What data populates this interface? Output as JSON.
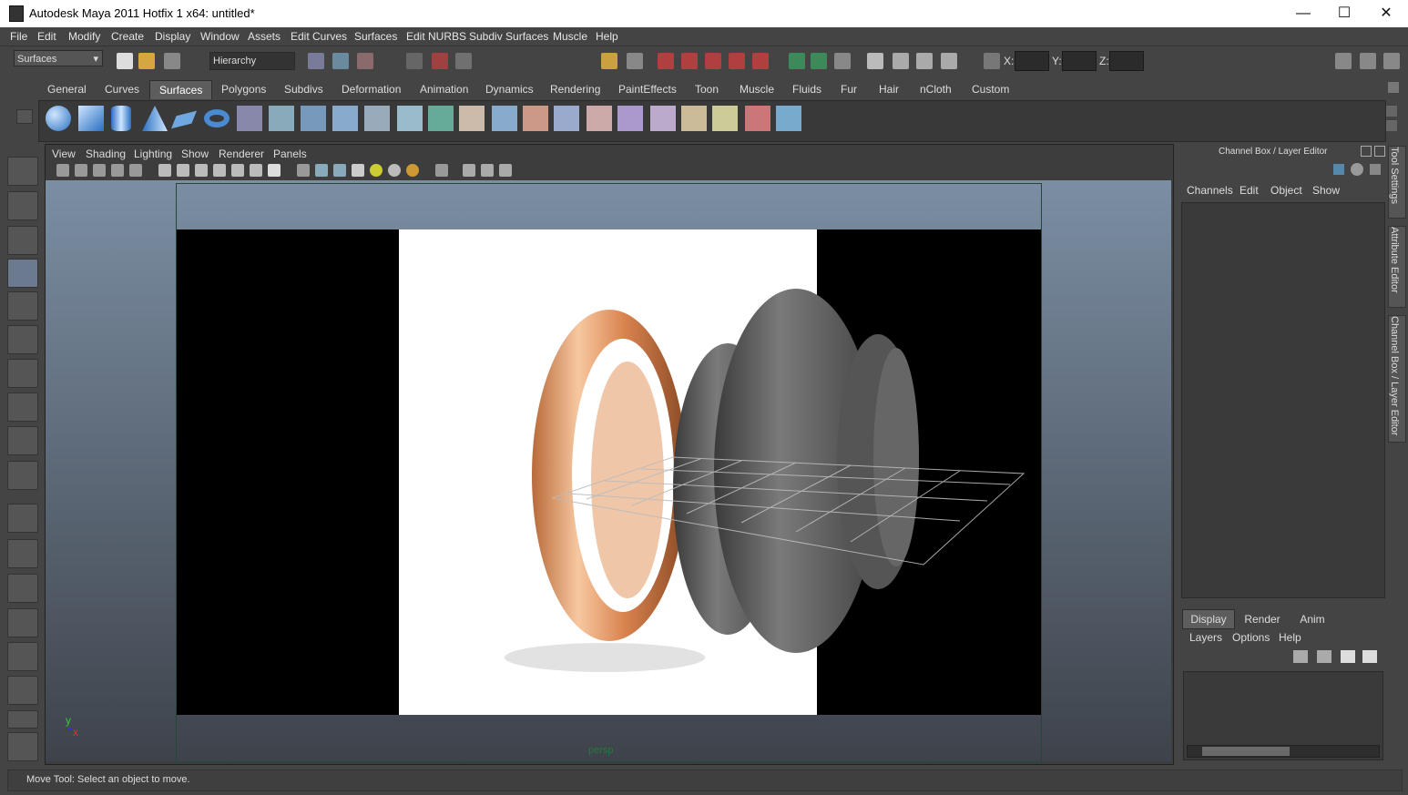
{
  "window": {
    "title": "Autodesk Maya 2011 Hotfix 1 x64: untitled*",
    "min": "—",
    "max": "☐",
    "close": "✕"
  },
  "menubar": [
    "File",
    "Edit",
    "Modify",
    "Create",
    "Display",
    "Window",
    "Assets",
    "Edit Curves",
    "Surfaces",
    "Edit NURBS",
    "Subdiv Surfaces",
    "Muscle",
    "Help"
  ],
  "statusline": {
    "menuset": "Surfaces",
    "selection_mode": "Hierarchy",
    "x_label": "X:",
    "y_label": "Y:",
    "z_label": "Z:"
  },
  "shelf": {
    "tabs": [
      "General",
      "Curves",
      "Surfaces",
      "Polygons",
      "Subdivs",
      "Deformation",
      "Animation",
      "Dynamics",
      "Rendering",
      "PaintEffects",
      "Toon",
      "Muscle",
      "Fluids",
      "Fur",
      "Hair",
      "nCloth",
      "Custom"
    ],
    "active_tab": "Surfaces"
  },
  "panel_menu": [
    "View",
    "Shading",
    "Lighting",
    "Show",
    "Renderer",
    "Panels"
  ],
  "viewport": {
    "camera_label": "persp",
    "axis_y": "y",
    "axis_x": "x"
  },
  "channel_box": {
    "title": "Channel Box / Layer Editor",
    "menus": [
      "Channels",
      "Edit",
      "Object",
      "Show"
    ]
  },
  "layer_editor": {
    "tabs": [
      "Display",
      "Render",
      "Anim"
    ],
    "active_tab": "Display",
    "menus": [
      "Layers",
      "Options",
      "Help"
    ]
  },
  "side_tabs": [
    "Tool Settings",
    "Attribute Editor",
    "Channel Box / Layer Editor"
  ],
  "help_line": "Move Tool: Select an object to move.",
  "colors": {
    "bg": "#444444",
    "viewport_top": "#7b8ea3",
    "viewport_bottom": "#3e434b",
    "ring": "#e8956a"
  }
}
